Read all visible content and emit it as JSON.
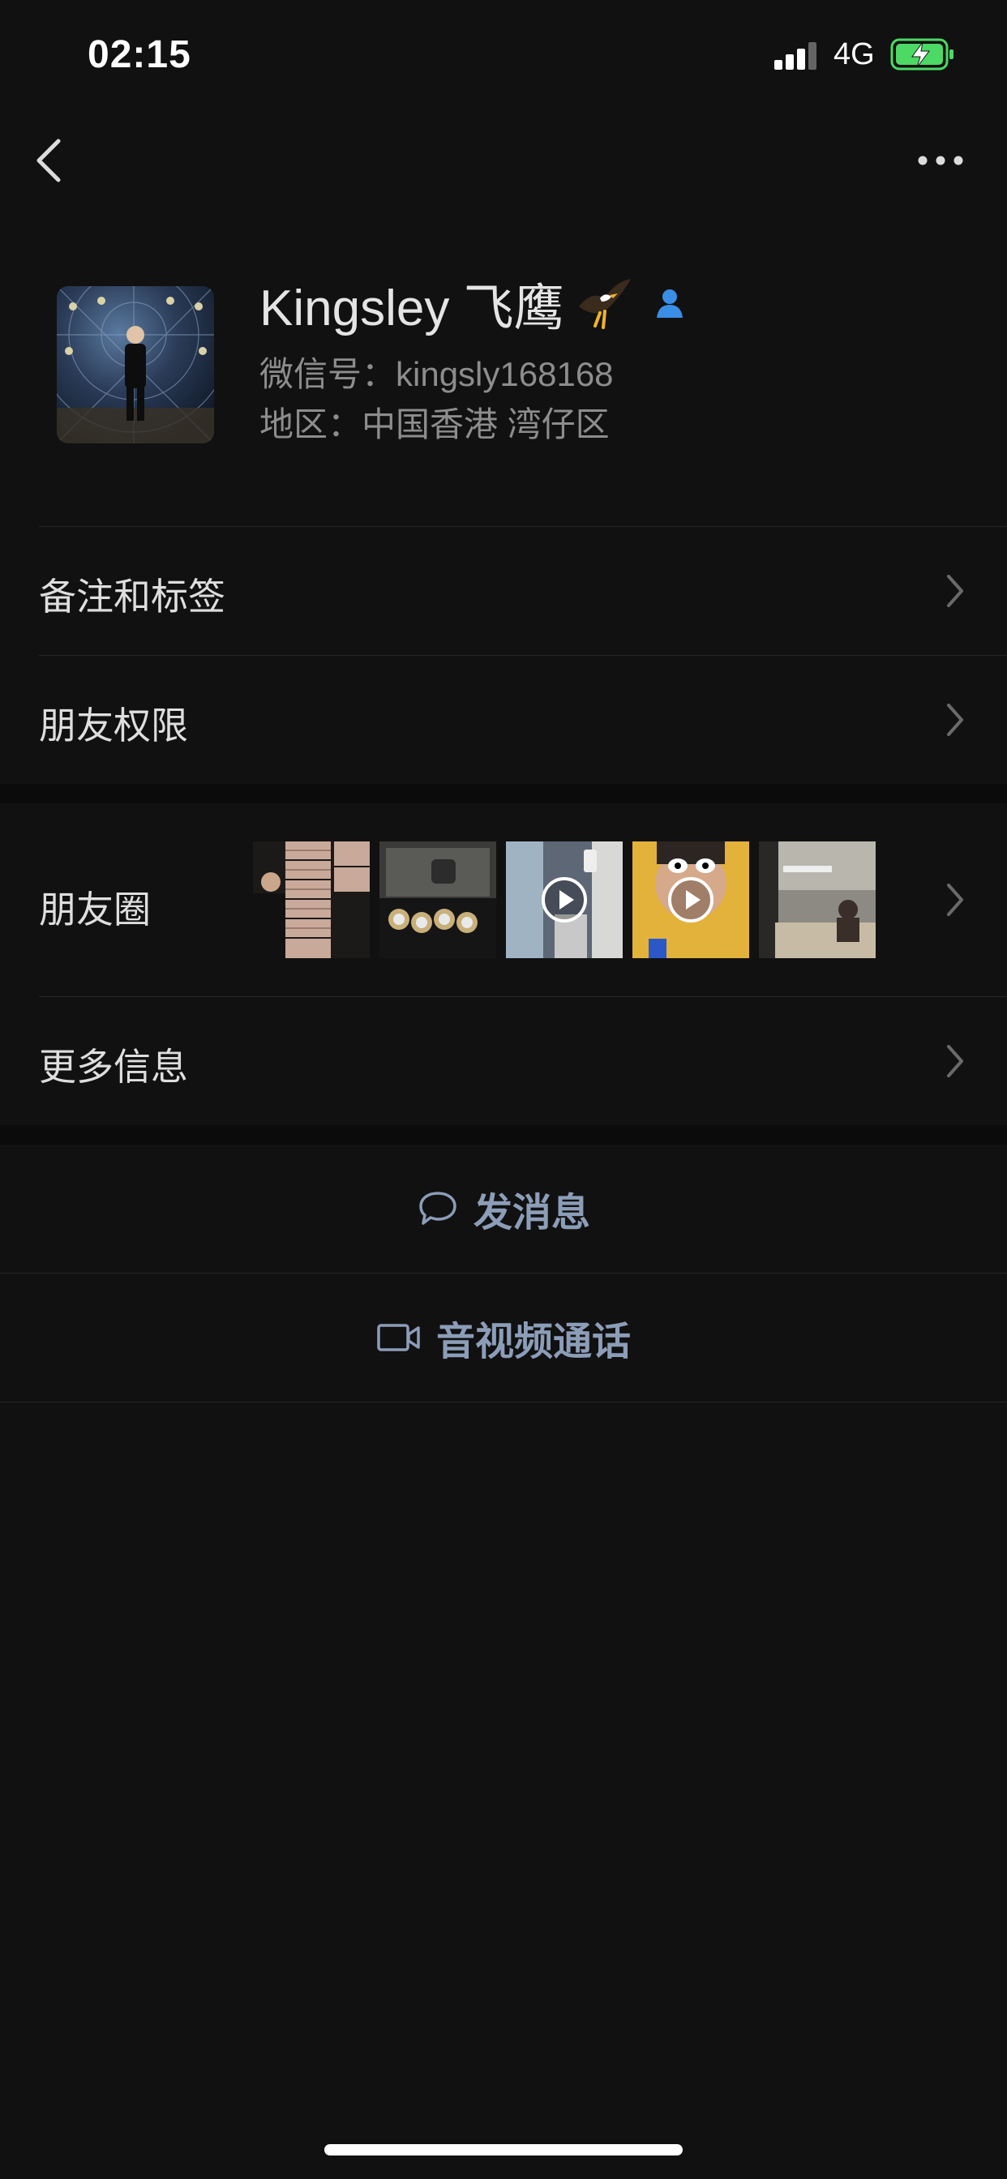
{
  "status_bar": {
    "time": "02:15",
    "network": "4G",
    "battery_icon": "battery-charging-icon"
  },
  "nav": {
    "back_icon": "chevron-left-icon",
    "more_icon": "more-icon"
  },
  "profile": {
    "name": "Kingsley 飞鹰",
    "name_emoji": "eagle-emoji",
    "badge_icon": "contact-person-icon",
    "wechat_id": "微信号：kingsly168168",
    "region": "地区：中国香港 湾仔区"
  },
  "rows": {
    "remarks_tags": "备注和标签",
    "friend_permissions": "朋友权限",
    "moments": "朋友圈",
    "more_info": "更多信息"
  },
  "actions": {
    "send_message": "发消息",
    "video_call": "音视频通话"
  },
  "colors": {
    "background": "#111111",
    "action_text": "#8c9db8",
    "battery_green": "#4cd964"
  }
}
